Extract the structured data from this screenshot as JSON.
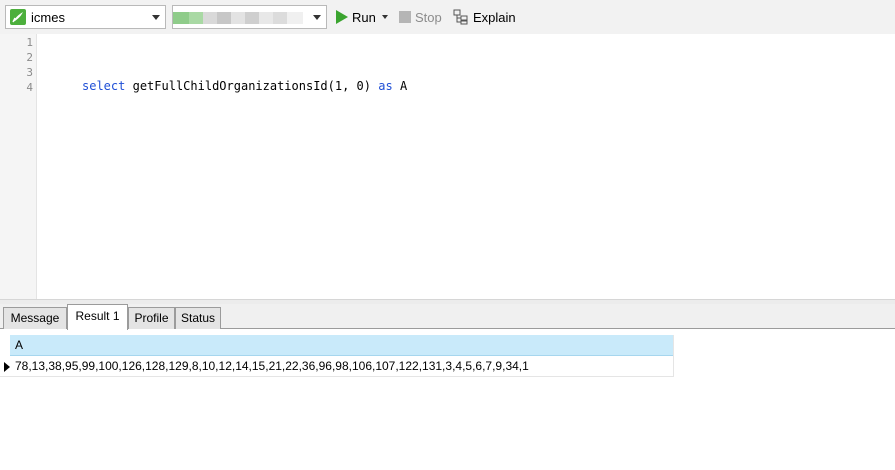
{
  "toolbar": {
    "connection": {
      "label": "icmes",
      "icon": "navicat-connection-icon"
    },
    "database": {
      "label": "",
      "icon": "chevron-down-icon"
    },
    "run_label": "Run",
    "stop_label": "Stop",
    "explain_label": "Explain",
    "colors": {
      "run": "#3aa42f",
      "stop": "#b5b5b5",
      "stop_text": "#8c8c8c"
    }
  },
  "editor": {
    "line_numbers": [
      "1",
      "2",
      "3",
      "4"
    ],
    "code": {
      "kw_select": "select",
      "call": "getFullChildOrganizationsId(1, 0)",
      "kw_as": "as",
      "alias": "A"
    },
    "keyword_color": "#1f4fd6"
  },
  "tabs": [
    {
      "label": "Message",
      "active": false
    },
    {
      "label": "Result 1",
      "active": true
    },
    {
      "label": "Profile",
      "active": false
    },
    {
      "label": "Status",
      "active": false
    }
  ],
  "result": {
    "columns": [
      "A"
    ],
    "rows": [
      [
        "78,13,38,95,99,100,126,128,129,8,10,12,14,15,21,22,36,96,98,106,107,122,131,3,4,5,6,7,9,34,1"
      ]
    ],
    "header_color": "#c9eafa"
  }
}
